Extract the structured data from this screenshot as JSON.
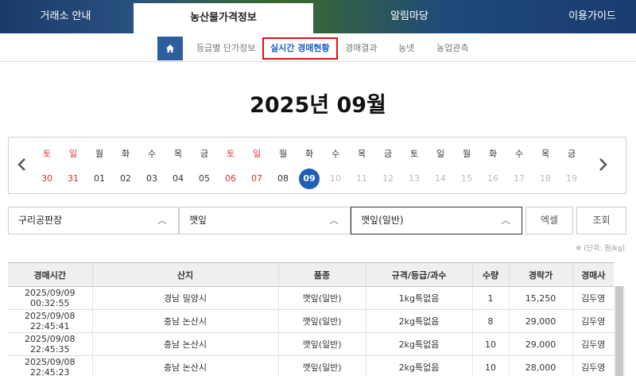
{
  "topnav": {
    "tabs": [
      {
        "label": "거래소 안내"
      },
      {
        "label": "농산물가격정보"
      },
      {
        "label": "알림마당"
      },
      {
        "label": "이용가이드"
      }
    ],
    "active_index": 1
  },
  "subnav": {
    "home_icon": "home-icon",
    "items": [
      {
        "label": "등급별 단가정보"
      },
      {
        "label": "실시간 경매현황"
      },
      {
        "label": "경매결과"
      },
      {
        "label": "농넷"
      },
      {
        "label": "농업관측"
      }
    ],
    "active_index": 1
  },
  "title": "2025년 09월",
  "calendar": {
    "prev_icon": "chevron-left-icon",
    "next_icon": "chevron-right-icon",
    "days": [
      {
        "dow": "토",
        "date": "30",
        "color": "red"
      },
      {
        "dow": "일",
        "date": "31",
        "color": "red"
      },
      {
        "dow": "월",
        "date": "01",
        "color": "black"
      },
      {
        "dow": "화",
        "date": "02",
        "color": "black"
      },
      {
        "dow": "수",
        "date": "03",
        "color": "black"
      },
      {
        "dow": "목",
        "date": "04",
        "color": "black"
      },
      {
        "dow": "금",
        "date": "05",
        "color": "black"
      },
      {
        "dow": "토",
        "date": "06",
        "color": "red"
      },
      {
        "dow": "일",
        "date": "07",
        "color": "red"
      },
      {
        "dow": "월",
        "date": "08",
        "color": "black"
      },
      {
        "dow": "화",
        "date": "09",
        "color": "today"
      },
      {
        "dow": "수",
        "date": "10",
        "color": "gray"
      },
      {
        "dow": "목",
        "date": "11",
        "color": "gray"
      },
      {
        "dow": "금",
        "date": "12",
        "color": "gray"
      },
      {
        "dow": "토",
        "date": "13",
        "color": "gray"
      },
      {
        "dow": "일",
        "date": "14",
        "color": "gray"
      },
      {
        "dow": "월",
        "date": "15",
        "color": "gray"
      },
      {
        "dow": "화",
        "date": "16",
        "color": "gray"
      },
      {
        "dow": "수",
        "date": "17",
        "color": "gray"
      },
      {
        "dow": "목",
        "date": "18",
        "color": "gray"
      },
      {
        "dow": "금",
        "date": "19",
        "color": "gray"
      }
    ]
  },
  "filters": {
    "market": "구리공판장",
    "item": "깻잎",
    "variety": "깻잎(일반)",
    "excel_label": "엑셀",
    "search_label": "조회"
  },
  "unit_note": "※ (단위: 원/kg)",
  "table": {
    "headers": [
      "경매시간",
      "산지",
      "품종",
      "규격/등급/과수",
      "수량",
      "경락가",
      "경매사"
    ],
    "rows": [
      [
        "2025/09/09 00:32:55",
        "경남 밀양시",
        "깻잎(일반)",
        "1kg특없음",
        "1",
        "15,250",
        "김두영"
      ],
      [
        "2025/09/08 22:45:41",
        "충남 논산시",
        "깻잎(일반)",
        "2kg특없음",
        "8",
        "29,000",
        "김두영"
      ],
      [
        "2025/09/08 22:45:35",
        "충남 논산시",
        "깻잎(일반)",
        "2kg특없음",
        "10",
        "29,000",
        "김두영"
      ],
      [
        "2025/09/08 22:45:23",
        "충남 논산시",
        "깻잎(일반)",
        "2kg특없음",
        "10",
        "28,000",
        "김두영"
      ]
    ]
  },
  "colors": {
    "accent": "#1f5fb5",
    "highlight_border": "#e01010",
    "weekend": "#e03030"
  }
}
